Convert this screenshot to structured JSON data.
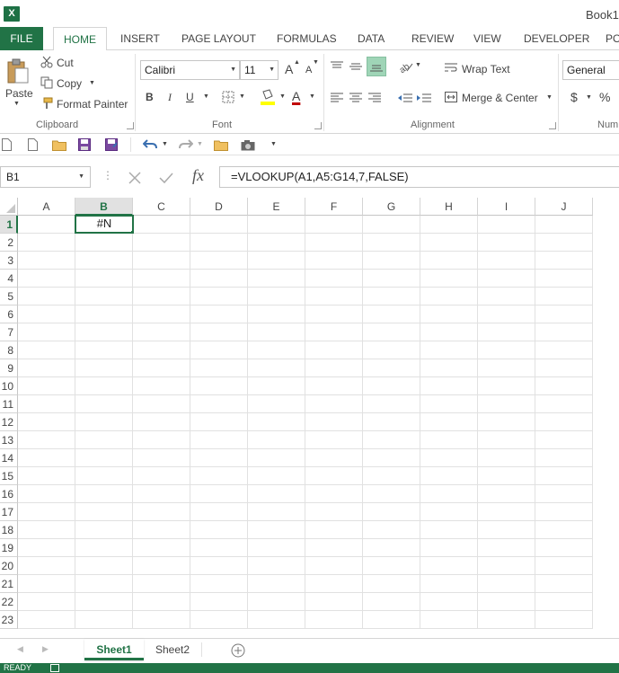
{
  "window": {
    "title": "Book1 -",
    "app_icon": "excel-logo",
    "logo_text": "X"
  },
  "ribbon_tabs": [
    "FILE",
    "HOME",
    "INSERT",
    "PAGE LAYOUT",
    "FORMULAS",
    "DATA",
    "REVIEW",
    "VIEW",
    "DEVELOPER",
    "PO"
  ],
  "active_tab": "HOME",
  "clipboard": {
    "paste_label": "Paste",
    "cut_label": "Cut",
    "copy_label": "Copy",
    "format_painter_label": "Format Painter",
    "group_label": "Clipboard"
  },
  "font": {
    "family": "Calibri",
    "size": "11",
    "grow_label": "A",
    "shrink_label": "A",
    "bold_label": "B",
    "italic_label": "I",
    "underline_label": "U",
    "font_color_label": "A",
    "group_label": "Font"
  },
  "alignment": {
    "wrap_text_label": "Wrap Text",
    "merge_center_label": "Merge & Center",
    "group_label": "Alignment"
  },
  "number": {
    "format": "General",
    "currency_label": "$",
    "percent_label": "%",
    "group_label": "Num"
  },
  "formula_bar": {
    "name_box": "B1",
    "fx_label": "fx",
    "formula": "=VLOOKUP(A1,A5:G14,7,FALSE)"
  },
  "grid": {
    "columns": [
      "A",
      "B",
      "C",
      "D",
      "E",
      "F",
      "G",
      "H",
      "I",
      "J"
    ],
    "rows": [
      "1",
      "2",
      "3",
      "4",
      "5",
      "6",
      "7",
      "8",
      "9",
      "10",
      "11",
      "12",
      "13",
      "14",
      "15",
      "16",
      "17",
      "18",
      "19",
      "20",
      "21",
      "22",
      "23"
    ],
    "active_cell": "B1",
    "active_cell_value": "#N"
  },
  "sheets": [
    "Sheet1",
    "Sheet2"
  ],
  "active_sheet": "Sheet1",
  "status": {
    "text": "READY"
  },
  "colors": {
    "excel_green": "#217346",
    "header_selected_bg": "#e1e1e1"
  }
}
